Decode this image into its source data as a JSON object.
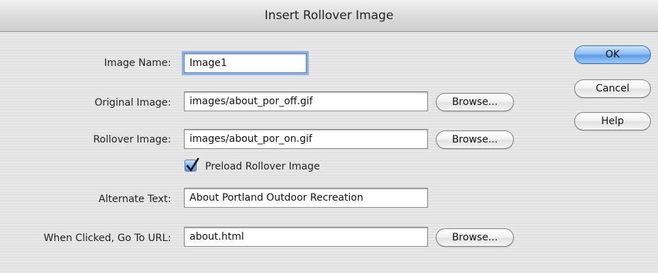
{
  "dialog": {
    "title": "Insert Rollover Image"
  },
  "form": {
    "image_name": {
      "label": "Image Name:",
      "value": "Image1"
    },
    "original_image": {
      "label": "Original Image:",
      "value": "images/about_por_off.gif",
      "browse_label": "Browse..."
    },
    "rollover_image": {
      "label": "Rollover Image:",
      "value": "images/about_por_on.gif",
      "browse_label": "Browse..."
    },
    "preload": {
      "label": "Preload Rollover Image",
      "checked": true
    },
    "alternate_text": {
      "label": "Alternate Text:",
      "value": "About Portland Outdoor Recreation"
    },
    "url": {
      "label": "When Clicked, Go To URL:",
      "value": "about.html",
      "browse_label": "Browse..."
    }
  },
  "buttons": {
    "ok": "OK",
    "cancel": "Cancel",
    "help": "Help"
  },
  "colors": {
    "default_button": "#5f9de6",
    "focus_ring": "#8db3e2"
  }
}
